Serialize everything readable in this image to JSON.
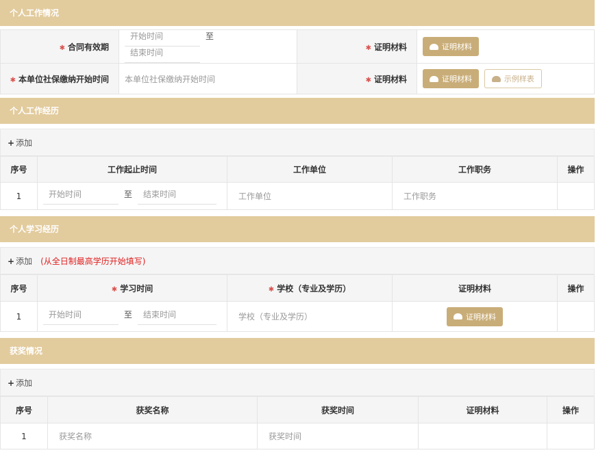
{
  "sections": {
    "work": {
      "title": "个人工作情况",
      "contract_label": "合同有效期",
      "start_ph": "开始时间",
      "to": "至",
      "end_ph": "结束时间",
      "proof_label": "证明材料",
      "proof_btn": "证明材料",
      "social_label": "本单位社保缴纳开始时间",
      "social_ph": "本单位社保缴纳开始时间",
      "sample_btn": "示例样表"
    },
    "experience": {
      "title": "个人工作经历",
      "add": "添加",
      "headers": [
        "序号",
        "工作起止时间",
        "工作单位",
        "工作职务",
        "操作"
      ],
      "row": {
        "no": "1",
        "start_ph": "开始时间",
        "to": "至",
        "end_ph": "结束时间",
        "unit_ph": "工作单位",
        "position_ph": "工作职务"
      }
    },
    "study": {
      "title": "个人学习经历",
      "add": "添加",
      "note": "(从全日制最高学历开始填写)",
      "headers": [
        "序号",
        "学习时间",
        "学校（专业及学历）",
        "证明材料",
        "操作"
      ],
      "row": {
        "no": "1",
        "start_ph": "开始时间",
        "to": "至",
        "end_ph": "结束时间",
        "school_ph": "学校（专业及学历）",
        "proof_btn": "证明材料"
      }
    },
    "awards": {
      "title": "获奖情况",
      "add": "添加",
      "headers": [
        "序号",
        "获奖名称",
        "获奖时间",
        "证明材料",
        "操作"
      ],
      "row": {
        "no": "1",
        "name_ph": "获奖名称",
        "time_ph": "获奖时间"
      }
    }
  },
  "colors": {
    "accent": "#e2cb9d",
    "button": "#c9ad78",
    "required": "#d9534f"
  }
}
